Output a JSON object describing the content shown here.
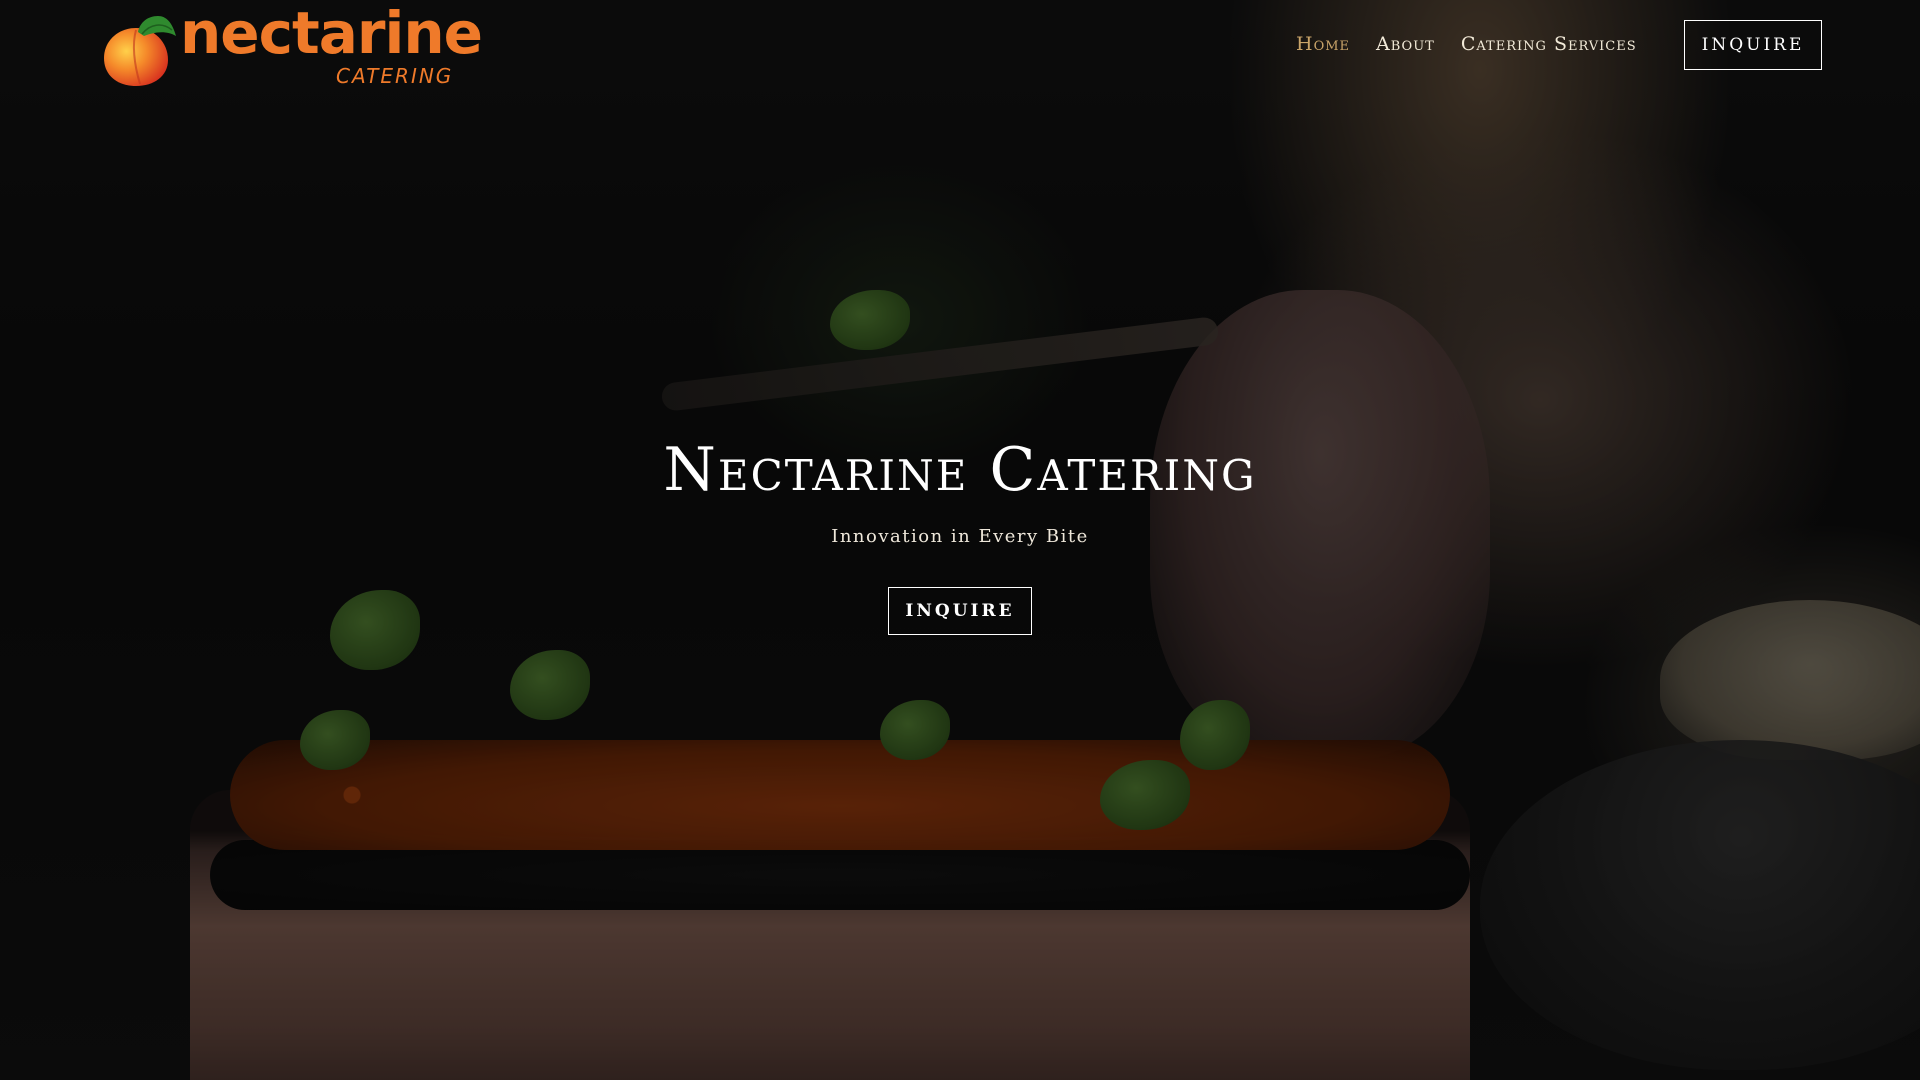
{
  "header": {
    "logo": {
      "wordmark": "nectarine",
      "subtitle": "CATERING",
      "icon": "peach-icon"
    },
    "nav": [
      {
        "label": "Home",
        "active": true
      },
      {
        "label": "About",
        "active": false
      },
      {
        "label": "Catering Services",
        "active": false
      }
    ],
    "cta_label": "INQUIRE"
  },
  "hero": {
    "title": "Nectarine Catering",
    "subtitle": "Innovation in Every Bite",
    "cta_label": "INQUIRE"
  },
  "colors": {
    "brand_orange": "#ef7a2a",
    "nav_active": "#c9a469",
    "nav_text": "#f2ead8",
    "overlay": "rgba(0,0,0,0.45)"
  }
}
